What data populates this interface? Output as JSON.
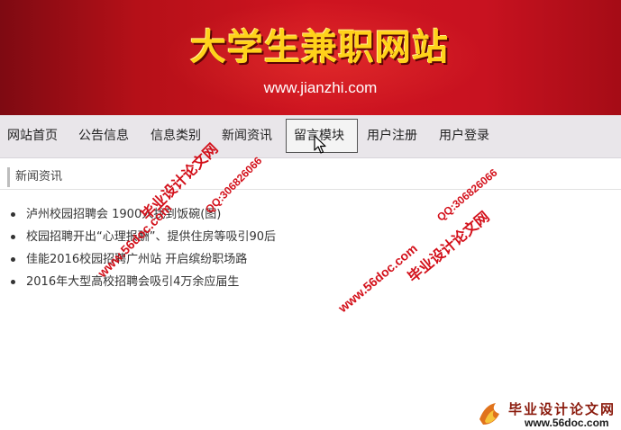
{
  "banner": {
    "title": "大学生兼职网站",
    "url": "www.jianzhi.com"
  },
  "nav": {
    "items": [
      {
        "label": "网站首页"
      },
      {
        "label": "公告信息"
      },
      {
        "label": "信息类别"
      },
      {
        "label": "新闻资讯"
      },
      {
        "label": "留言模块"
      },
      {
        "label": "用户注册"
      },
      {
        "label": "用户登录"
      }
    ]
  },
  "section": {
    "title": "新闻资讯"
  },
  "news": [
    {
      "title": "泸州校园招聘会 1900人找到饭碗(图)"
    },
    {
      "title": "校园招聘开出“心理报酬”、提供住房等吸引90后"
    },
    {
      "title": "佳能2016校园招聘广州站 开启缤纷职场路"
    },
    {
      "title": "2016年大型高校招聘会吸引4万余应届生"
    }
  ],
  "watermarks": {
    "site_cn": "毕业设计论文网",
    "site_url": "www.56doc.com",
    "qq": "QQ:306826066"
  },
  "corner_logo": {
    "cn": "毕业设计论文网",
    "url": "www.56doc.com"
  },
  "colors": {
    "banner_red": "#cf1420",
    "title_yellow": "#ffd21a",
    "watermark_red": "#d3101a",
    "nav_bg": "#e9e6ea"
  }
}
